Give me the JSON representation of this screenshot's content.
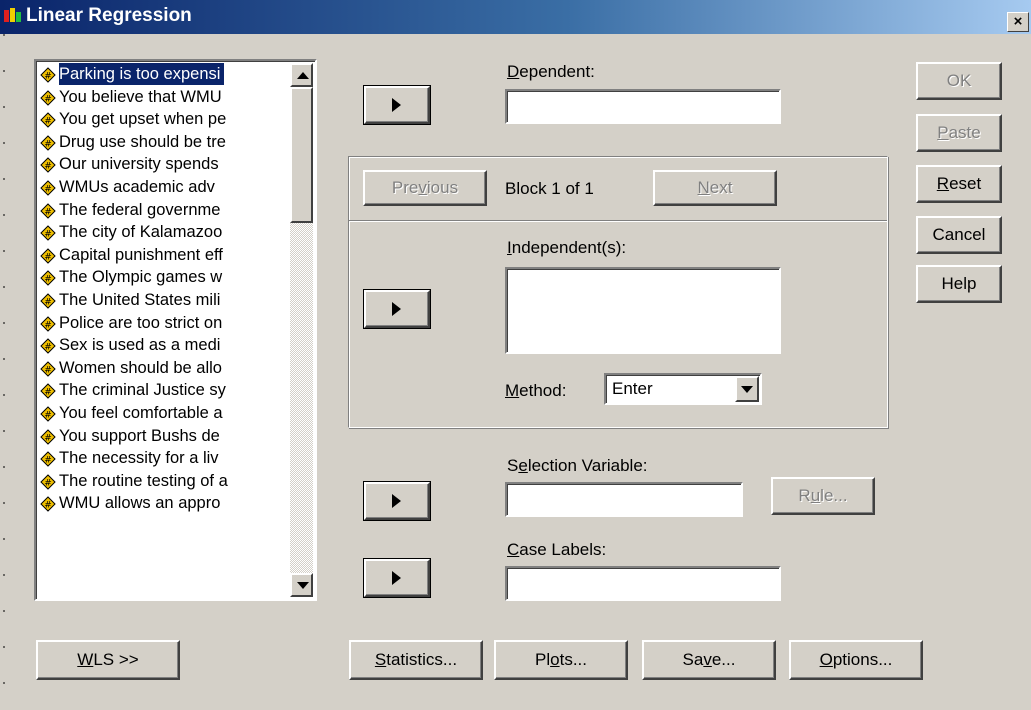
{
  "window": {
    "title": "Linear Regression",
    "close_label": "×"
  },
  "variables": {
    "items": [
      "Parking is too expensi",
      "You believe that WMU",
      "You get upset when pe",
      "Drug use should be tre",
      "Our university spends",
      "WMUs academic adv",
      "The federal governme",
      "The city of Kalamazoo",
      "Capital punishment eff",
      "The Olympic games w",
      "The United States mili",
      "Police are too strict on",
      "Sex is used as a medi",
      "Women should be allo",
      "The criminal Justice sy",
      "You feel comfortable a",
      "You support Bushs de",
      "The necessity for a liv",
      "The routine testing of a",
      "WMU allows an appro"
    ],
    "selected_index": 0,
    "item_icon": "scale-variable-icon"
  },
  "dependent": {
    "label_prefix": "",
    "label_mnemonic": "D",
    "label_rest": "ependent:",
    "value": ""
  },
  "block": {
    "previous_pre": "Pre",
    "previous_mnemonic": "v",
    "previous_post": "ious",
    "status": "Block 1 of 1",
    "next_mnemonic": "N",
    "next_rest": "ext"
  },
  "independents": {
    "label_mnemonic": "I",
    "label_rest": "ndependent(s):",
    "value": ""
  },
  "method": {
    "label_mnemonic": "M",
    "label_rest": "ethod:",
    "value": "Enter"
  },
  "selection": {
    "label_pre": "S",
    "label_mnemonic": "e",
    "label_rest": "lection Variable:",
    "value": "",
    "rule_pre": "R",
    "rule_mnemonic": "u",
    "rule_rest": "le..."
  },
  "case_labels": {
    "label_mnemonic": "C",
    "label_rest": "ase Labels:",
    "value": ""
  },
  "side_buttons": {
    "ok": "OK",
    "paste_mnemonic": "P",
    "paste_rest": "aste",
    "reset_mnemonic": "R",
    "reset_rest": "eset",
    "cancel": "Cancel",
    "help": "Help"
  },
  "bottom_buttons": {
    "wls_mnemonic": "W",
    "wls_rest": "LS >>",
    "statistics_mnemonic": "S",
    "statistics_rest": "tatistics...",
    "plots_pre": "Pl",
    "plots_mnemonic": "o",
    "plots_rest": "ts...",
    "save_pre": "Sa",
    "save_mnemonic": "v",
    "save_rest": "e...",
    "options_mnemonic": "O",
    "options_rest": "ptions..."
  }
}
